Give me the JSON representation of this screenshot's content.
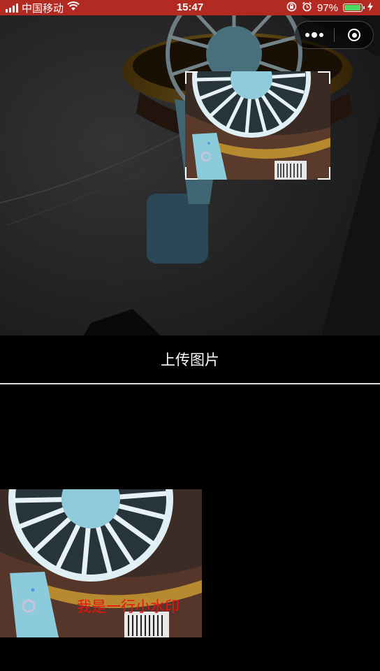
{
  "status_bar": {
    "carrier": "中国移动",
    "time": "15:47",
    "battery_percent": "97%",
    "battery_level": 0.97,
    "icons": [
      "signal-icon",
      "wifi-icon",
      "rotation-lock-icon",
      "alarm-icon",
      "battery-icon",
      "charging-icon"
    ],
    "background_color": "#b22a22"
  },
  "capsule": {
    "more_icon": "more-dots-icon",
    "close_icon": "target-close-icon"
  },
  "upload_button": {
    "label": "上传图片"
  },
  "result": {
    "watermark_text": "我是一行小水印",
    "watermark_color": "#ee1111"
  },
  "colors": {
    "background": "#000000",
    "divider": "#d9d9d9",
    "crop_corner": "#ffffff"
  }
}
